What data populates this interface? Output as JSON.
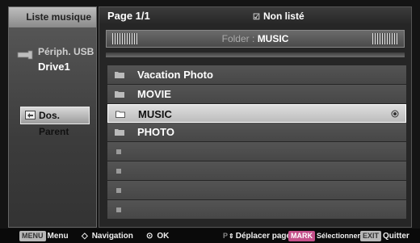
{
  "left": {
    "title": "Liste musique",
    "device_label": "Périph. USB",
    "drive": "Drive1",
    "parent_button": "Dos. Parent"
  },
  "top": {
    "page": "Page 1/1",
    "non_liste": "Non listé"
  },
  "folder": {
    "label": "Folder",
    "separator": ":",
    "name": "MUSIC"
  },
  "list": {
    "items": [
      "Vacation  Photo",
      "MOVIE",
      "MUSIC",
      "PHOTO"
    ],
    "selected_index": 2,
    "empty_rows": 4
  },
  "bottom": {
    "menu_key": "MENU",
    "menu_label": "Menu",
    "nav_label": "Navigation",
    "ok_label": "OK",
    "page_key": "P",
    "page_label": "Déplacer page",
    "mark_key": "MARK",
    "mark_label": "Sélectionner",
    "exit_key": "EXIT",
    "exit_label": "Quitter"
  },
  "colors": {
    "background": "#141414",
    "row": "#4d4d4d",
    "row_selected": "#cfcfcf",
    "header": "#9a9a9a"
  }
}
